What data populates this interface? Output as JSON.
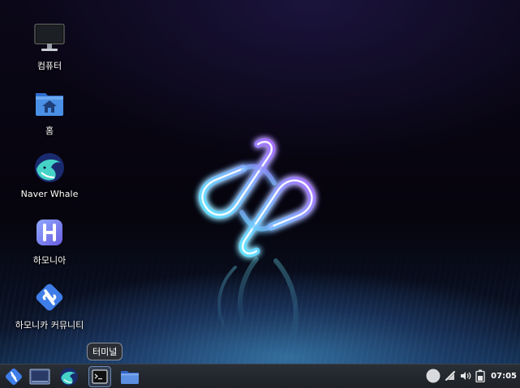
{
  "desktop": {
    "icons": [
      {
        "label": "컴퓨터",
        "icon": "computer-icon"
      },
      {
        "label": "홈",
        "icon": "home-folder-icon"
      },
      {
        "label": "Naver Whale",
        "icon": "naver-whale-icon"
      },
      {
        "label": "하모니아",
        "icon": "hamonia-icon"
      },
      {
        "label": "하모니카 커뮤니티",
        "icon": "hamonikr-community-icon"
      }
    ]
  },
  "taskbar": {
    "launchers": [
      {
        "name": "app-menu-button",
        "icon": "hamonikr-logo-icon"
      },
      {
        "name": "show-desktop-button",
        "icon": "desktop-icon"
      },
      {
        "name": "whale-launcher",
        "icon": "naver-whale-icon"
      },
      {
        "name": "terminal-launcher",
        "icon": "terminal-icon",
        "active": true
      },
      {
        "name": "files-launcher",
        "icon": "folder-icon"
      }
    ],
    "tooltip": "터미널",
    "tray": {
      "icons": [
        "user-status-icon",
        "network-icon",
        "volume-icon",
        "battery-icon"
      ],
      "clock": "07:05"
    }
  },
  "colors": {
    "accent": "#5b8fd6",
    "taskbar_bg": "#1d2126",
    "glow_cyan": "#6fe6ff",
    "glow_purple": "#a06bff"
  }
}
